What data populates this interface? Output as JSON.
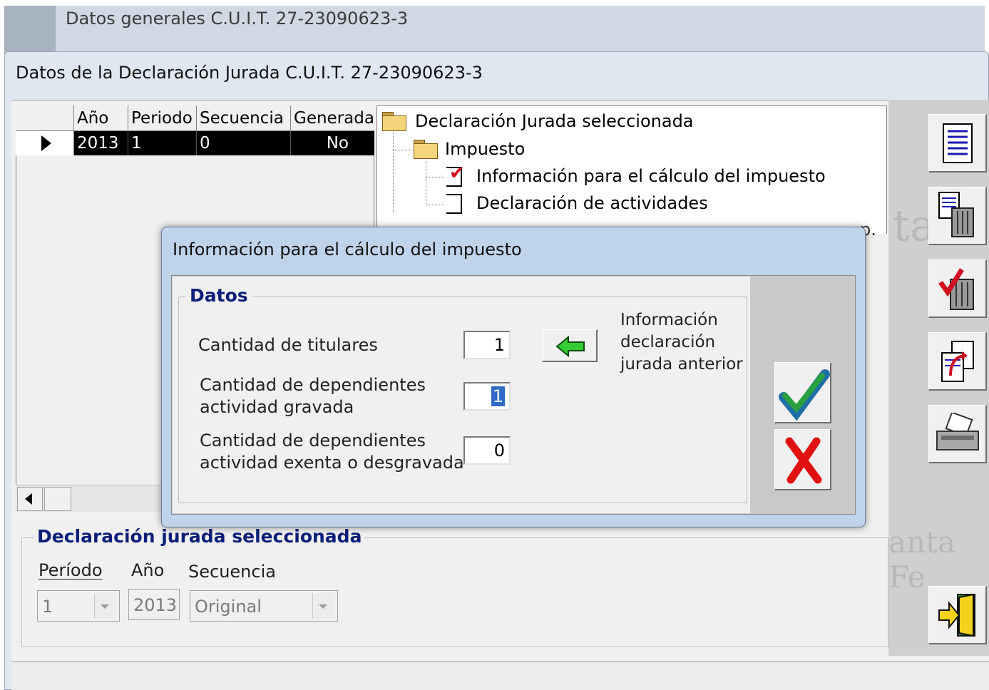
{
  "back_window": {
    "title": "Datos generales C.U.I.T. 27-23090623-3"
  },
  "main_window": {
    "title": "Datos de la Declaración Jurada C.U.I.T. 27-23090623-3"
  },
  "grid": {
    "columns": [
      "Año",
      "Periodo",
      "Secuencia",
      "Generada"
    ],
    "rows": [
      {
        "anio": "2013",
        "periodo": "1",
        "secuencia": "0",
        "generada": "No"
      }
    ]
  },
  "tree": {
    "root": "Declaración Jurada seleccionada",
    "impuesto": "Impuesto",
    "item_calculo": "Información para el cálculo del impuesto",
    "item_actividades": "Declaración de actividades",
    "hidden_peek": "p."
  },
  "watermark": {
    "text": "anta Fe",
    "letters": "ta"
  },
  "lower_group": {
    "title": "Declaración jurada seleccionada",
    "label_periodo": "Período",
    "label_anio": "Año",
    "label_secuencia": "Secuencia",
    "value_periodo": "1",
    "value_anio": "2013",
    "value_secuencia": "Original"
  },
  "dialog": {
    "title": "Información para el cálculo del impuesto",
    "frame_title": "Datos",
    "label_titulares": "Cantidad de titulares",
    "label_dep_gravada_1": "Cantidad de dependientes",
    "label_dep_gravada_2": "actividad gravada",
    "label_dep_exenta_1": "Cantidad de dependientes",
    "label_dep_exenta_2": "actividad exenta o desgravada",
    "value_titulares": "1",
    "value_dep_gravada": "1",
    "value_dep_exenta": "0",
    "info_1": "Información",
    "info_2": "declaración",
    "info_3": "jurada anterior"
  },
  "colors": {
    "accent_title": "#0b1e78",
    "selection": "#000000",
    "ok_green": "#1f7a2e",
    "cancel_red": "#e01010"
  }
}
